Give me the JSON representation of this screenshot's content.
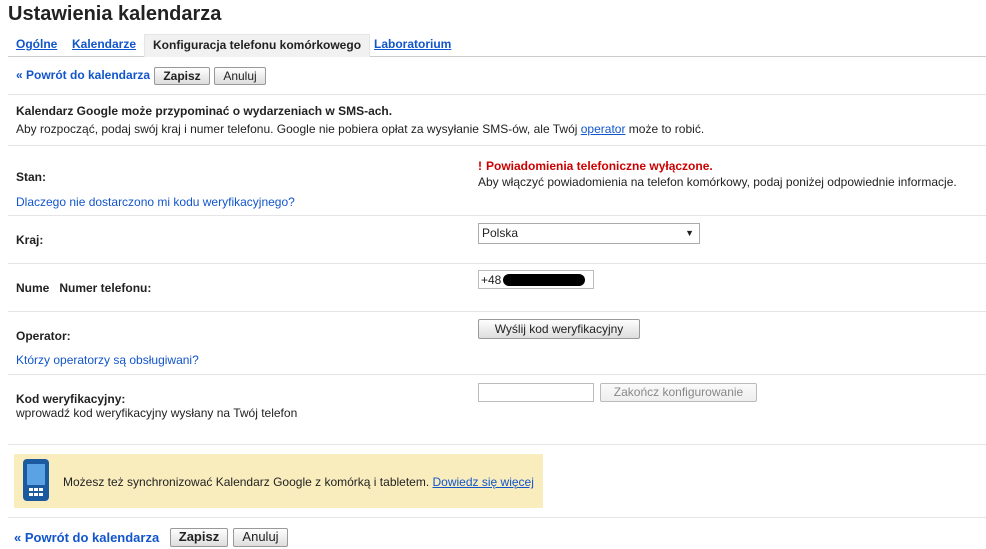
{
  "page": {
    "title": "Ustawienia kalendarza"
  },
  "tabs": [
    {
      "label": "Ogólne"
    },
    {
      "label": "Kalendarze"
    },
    {
      "label": "Konfiguracja telefonu komórkowego"
    },
    {
      "label": "Laboratorium"
    }
  ],
  "toolbar": {
    "back_label": "« Powrót do kalendarza",
    "save_label": "Zapisz",
    "cancel_label": "Anuluj"
  },
  "intro": {
    "heading": "Kalendarz Google może przypominać o wydarzeniach w SMS-ach.",
    "text_before": "Aby rozpocząć, podaj swój kraj i numer telefonu. Google nie pobiera opłat za wysyłanie SMS-ów, ale Twój ",
    "operator_link": "operator",
    "text_after": " może to robić."
  },
  "status": {
    "label": "Stan:",
    "help_link": "Dlaczego nie dostarczono mi kodu weryfikacyjnego?",
    "warning_icon": "exclamation-icon",
    "warning_color": "#cc0000",
    "warning_title": "Powiadomienia telefoniczne wyłączone.",
    "warning_text": "Aby włączyć powiadomienia na telefon komórkowy, podaj poniżej odpowiednie informacje."
  },
  "country": {
    "label": "Kraj:",
    "selected": "Polska"
  },
  "phone": {
    "label": "Nume   Numer telefonu:",
    "value": "+48"
  },
  "carrier": {
    "label": "Operator:",
    "send_code_label": "Wyślij kod weryfikacyjny",
    "supported_link": "Którzy operatorzy są obsługiwani?"
  },
  "verification": {
    "label": "Kod weryfikacyjny:",
    "hint": "wprowadź kod weryfikacyjny wysłany na Twój telefon",
    "input_value": "",
    "finish_label": "Zakończ konfigurowanie"
  },
  "promo": {
    "icon": "mobile-phone-icon",
    "text": "Możesz też synchronizować Kalendarz Google z komórką i tabletem. ",
    "link": "Dowiedz się więcej",
    "background": "#f9edbe"
  },
  "footer": {
    "back_label": "« Powrót do kalendarza",
    "save_label": "Zapisz",
    "cancel_label": "Anuluj"
  }
}
